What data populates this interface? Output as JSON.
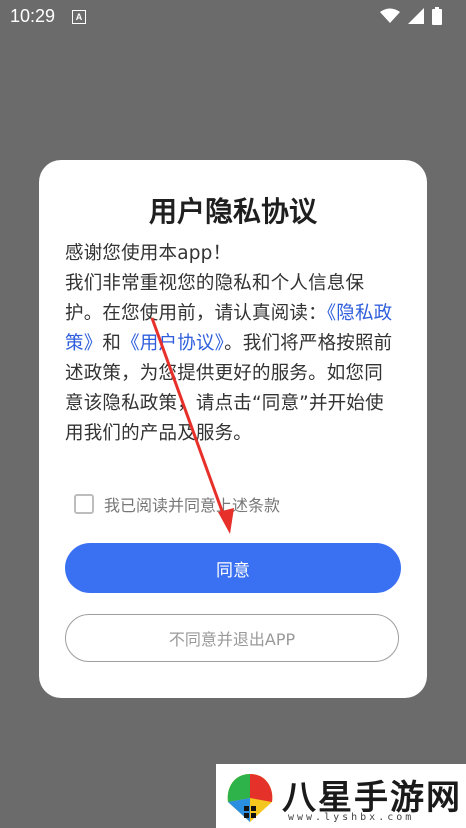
{
  "status_bar": {
    "time": "10:29",
    "notification_icon": "A",
    "icons": [
      "wifi-icon",
      "signal-icon",
      "battery-icon"
    ]
  },
  "dialog": {
    "title": "用户隐私协议",
    "greeting": "感谢您使用本app！",
    "body_before_links": "我们非常重视您的隐私和个人信息保护。在您使用前，请认真阅读：",
    "link_privacy_policy": "《隐私政策》",
    "connector": "和",
    "link_user_agreement": "《用户协议》",
    "body_after_links": "。我们将严格按照前述政策，为您提供更好的服务。如您同意该隐私政策，请点击“同意”并开始使用我们的产品及服务。",
    "checkbox_label": "我已阅读并同意上述条款",
    "checkbox_checked": false,
    "agree_button": "同意",
    "exit_button": "不同意并退出APP"
  },
  "watermark": {
    "text": "八星手游网",
    "url": "www.lyshbx.com"
  },
  "colors": {
    "primary": "#3a71f2",
    "link": "#2f5fdc",
    "overlay": "#6b6b6b",
    "annotation_arrow": "#e8302a"
  }
}
